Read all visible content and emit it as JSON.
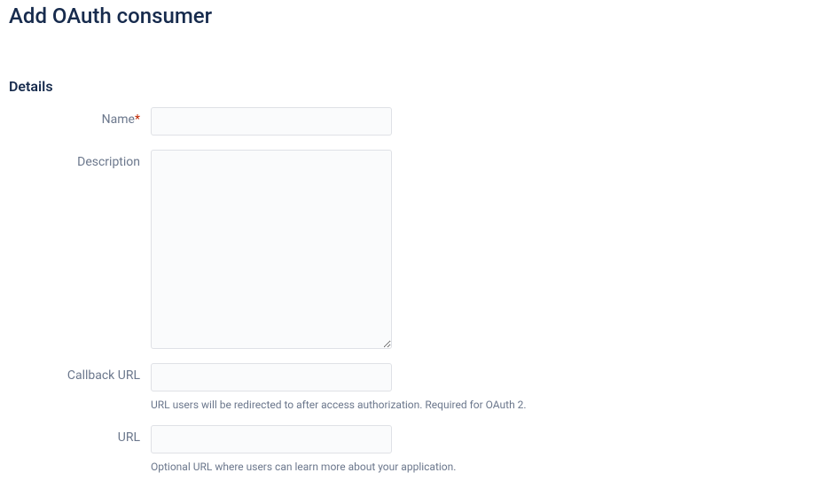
{
  "page": {
    "title": "Add OAuth consumer"
  },
  "section": {
    "heading": "Details"
  },
  "form": {
    "name": {
      "label": "Name",
      "required": "*",
      "value": ""
    },
    "description": {
      "label": "Description",
      "value": ""
    },
    "callback_url": {
      "label": "Callback URL",
      "value": "",
      "help": "URL users will be redirected to after access authorization. Required for OAuth 2."
    },
    "url": {
      "label": "URL",
      "value": "",
      "help": "Optional URL where users can learn more about your application."
    }
  }
}
